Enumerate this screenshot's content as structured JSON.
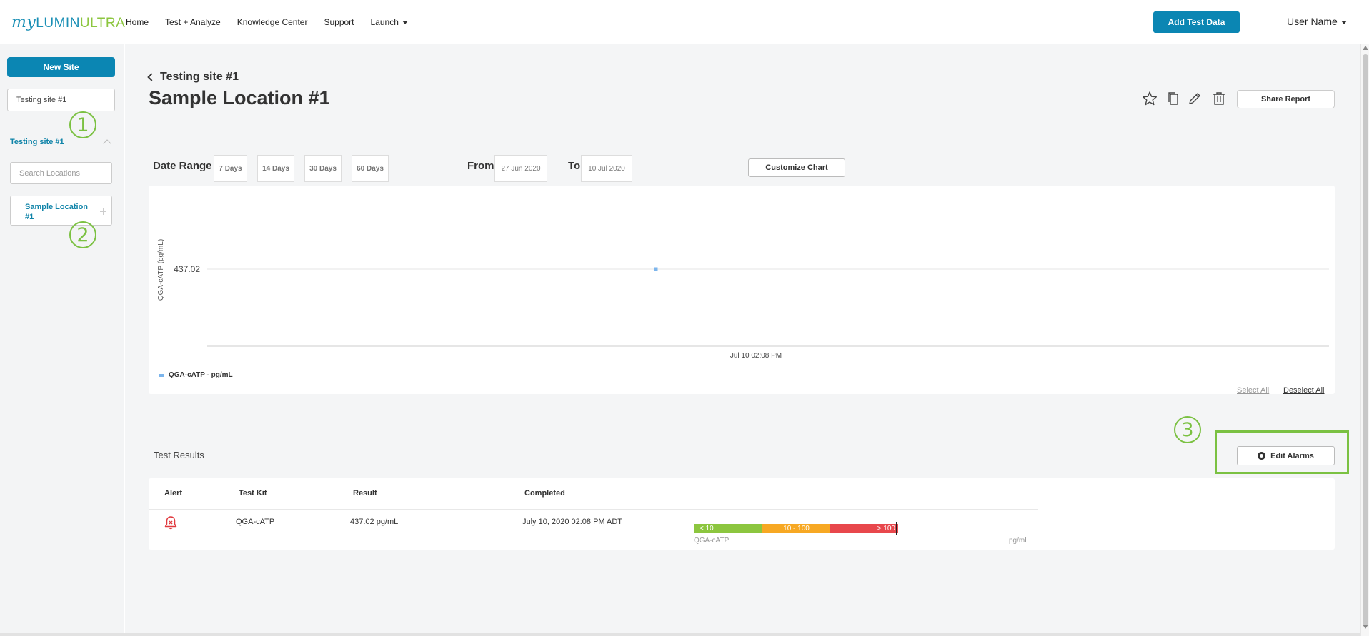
{
  "header": {
    "logo": {
      "my": "my",
      "lumin": "LUMIN",
      "ultra": "ULTRA"
    },
    "nav": [
      {
        "label": "Home"
      },
      {
        "label": "Test + Analyze",
        "active": true
      },
      {
        "label": "Knowledge Center"
      },
      {
        "label": "Support"
      },
      {
        "label": "Launch",
        "dropdown": true
      }
    ],
    "add_test_label": "Add Test Data",
    "user_label": "User Name"
  },
  "sidebar": {
    "new_site_label": "New Site",
    "site_select_value": "Testing site #1",
    "site_group_label": "Testing site #1",
    "search_placeholder": "Search Locations",
    "location_item_label": "Sample Location #1"
  },
  "callouts": [
    "1",
    "2",
    "3"
  ],
  "page": {
    "breadcrumb": "Testing site #1",
    "title": "Sample Location #1",
    "share_label": "Share Report",
    "icons": [
      "star-icon",
      "copy-icon",
      "pencil-icon",
      "trash-icon"
    ]
  },
  "date_range": {
    "label": "Date Range",
    "options": [
      "7 Days",
      "14 Days",
      "30 Days",
      "60 Days"
    ],
    "from_label": "From",
    "from_value": "27 Jun 2020",
    "to_label": "To",
    "to_value": "10 Jul 2020",
    "customize_label": "Customize Chart"
  },
  "chart_data": {
    "type": "scatter",
    "ylabel": "QGA-cATP (pg/mL)",
    "xlabel": "",
    "y_ticks": [
      "437.02"
    ],
    "x_ticks": [
      "Jul 10 02:08 PM"
    ],
    "series": [
      {
        "name": "QGA-cATP - pg/mL",
        "color": "#7cb5ec",
        "points": [
          {
            "x": "Jul 10 02:08 PM",
            "y": 437.02
          }
        ]
      }
    ],
    "grid": true,
    "legend": "bottom-left"
  },
  "chart_links": {
    "select_all": "Select All",
    "deselect_all": "Deselect All"
  },
  "results": {
    "title": "Test Results",
    "edit_alarms_label": "Edit Alarms",
    "columns": [
      "Alert",
      "Test Kit",
      "Result",
      "Completed"
    ],
    "rows": [
      {
        "test_kit": "QGA-cATP",
        "result": "437.02 pg/mL",
        "completed": "July 10, 2020 02:08 PM ADT",
        "gauge": {
          "segments": [
            {
              "label": "< 10",
              "color": "#8cc63f"
            },
            {
              "label": "10 - 100",
              "color": "#f7a823"
            },
            {
              "label": "> 100",
              "color": "#e8474c"
            }
          ],
          "kit": "QGA-cATP",
          "unit": "pg/mL"
        }
      }
    ]
  },
  "colors": {
    "primary": "#0b86b3",
    "callout": "#7bc142",
    "series": "#7cb5ec"
  }
}
